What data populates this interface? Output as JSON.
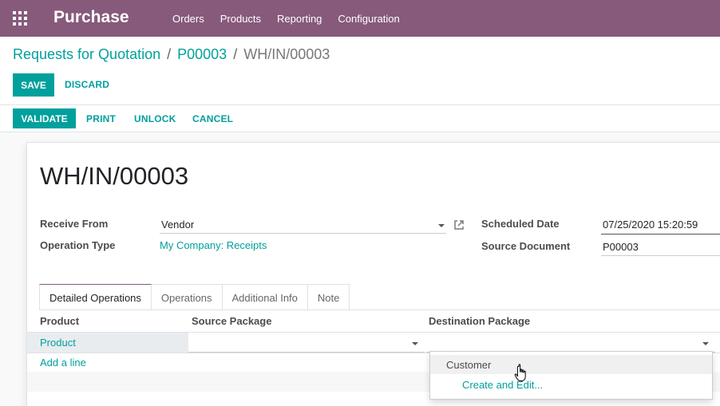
{
  "navbar": {
    "brand": "Purchase",
    "menu": [
      "Orders",
      "Products",
      "Reporting",
      "Configuration"
    ],
    "apps_icon": "apps-grid-icon"
  },
  "breadcrumb": {
    "items": [
      "Requests for Quotation",
      "P00003"
    ],
    "separator": "/",
    "active": "WH/IN/00003"
  },
  "control": {
    "save_label": "SAVE",
    "discard_label": "DISCARD"
  },
  "statusbar": {
    "validate_label": "VALIDATE",
    "print_label": "PRINT",
    "unlock_label": "UNLOCK",
    "cancel_label": "CANCEL"
  },
  "form": {
    "title": "WH/IN/00003",
    "receive_from_label": "Receive From",
    "receive_from_value": "Vendor",
    "operation_type_label": "Operation Type",
    "operation_type_value": "My Company: Receipts",
    "scheduled_date_label": "Scheduled Date",
    "scheduled_date_value": "07/25/2020 15:20:59",
    "source_document_label": "Source Document",
    "source_document_value": "P00003"
  },
  "tabs": [
    {
      "label": "Detailed Operations",
      "active": true
    },
    {
      "label": "Operations",
      "active": false
    },
    {
      "label": "Additional Info",
      "active": false
    },
    {
      "label": "Note",
      "active": false
    }
  ],
  "table": {
    "headers": [
      "Product",
      "Source Package",
      "Destination Package"
    ],
    "row": {
      "product": "Product",
      "source_package": "",
      "destination_package": ""
    },
    "add_line": "Add a line"
  },
  "dropdown": {
    "items": [
      "Customer",
      "Create and Edit..."
    ]
  },
  "colors": {
    "brand": "#875a7b",
    "accent": "#00a09d"
  }
}
